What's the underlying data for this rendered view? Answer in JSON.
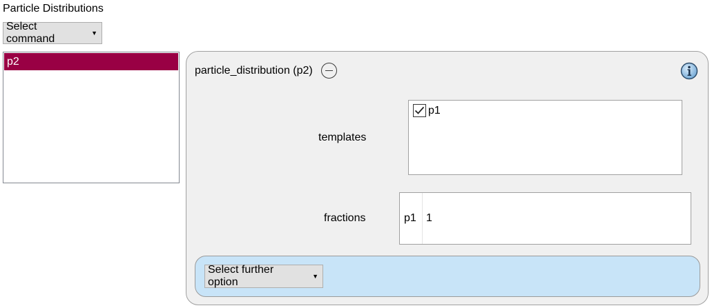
{
  "section": {
    "title": "Particle Distributions"
  },
  "command_combo": {
    "label": "Select command",
    "arrow_icon": "chevron-down-icon"
  },
  "distribution_list": {
    "items": [
      {
        "label": "p2",
        "selected": true
      }
    ],
    "selected_color": "#990044"
  },
  "panel": {
    "title": "particle_distribution (p2)",
    "collapse_icon": "minus-circle-icon",
    "info_icon": "info-icon",
    "templates": {
      "label": "templates",
      "options": [
        {
          "label": "p1",
          "checked": true
        }
      ]
    },
    "fractions": {
      "label": "fractions",
      "rows": [
        {
          "key": "p1",
          "value": "1"
        }
      ]
    },
    "further": {
      "label": "Select further option",
      "bg_color": "#c8e4f8"
    }
  }
}
